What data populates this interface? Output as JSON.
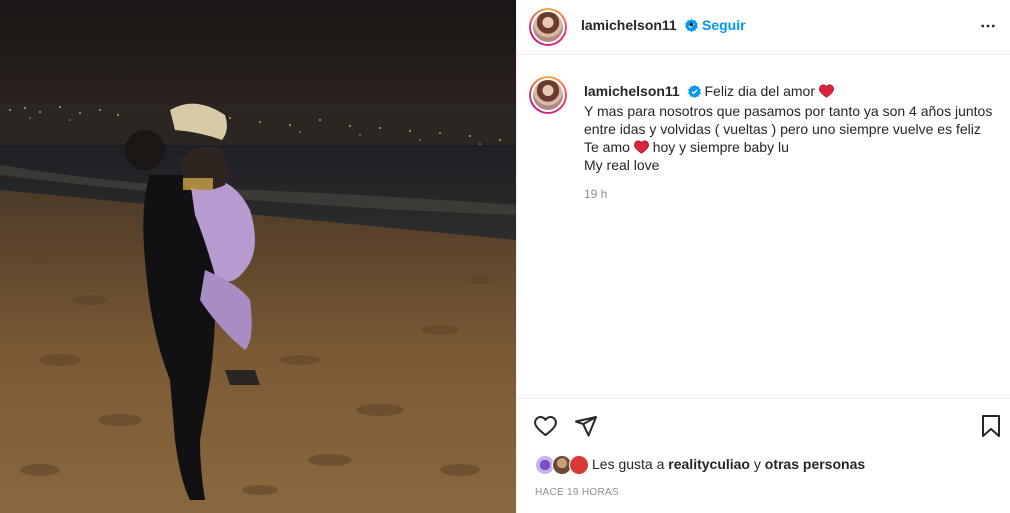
{
  "post": {
    "username": "lamichelson11",
    "follow_label": "Seguir",
    "separator": "•",
    "caption_lines": [
      "Feliz dia del amor",
      "Y mas para nosotros que pasamos por tanto ya son 4 años juntos",
      "entre idas y volvidas ( vueltas ) pero uno siempre vuelve es feliz",
      "Te amo",
      "hoy y siempre baby lu",
      "My real love"
    ],
    "time_short": "19 h",
    "likes_prefix": "Les gusta a",
    "likes_user": "realityculiao",
    "likes_mid": "y",
    "likes_others": "otras personas",
    "time_ago": "HACE 19 HORAS"
  },
  "icons": {
    "verified": "verified-badge-icon",
    "more": "more-options-icon",
    "heart_emoji": "red-heart-emoji",
    "like": "heart-outline-icon",
    "share": "paper-plane-icon",
    "save": "bookmark-icon"
  },
  "colors": {
    "link_blue": "#0095f6",
    "verified_blue": "#0095f6",
    "heart_red": "#e0233a",
    "muted_text": "#8e8e8e"
  }
}
